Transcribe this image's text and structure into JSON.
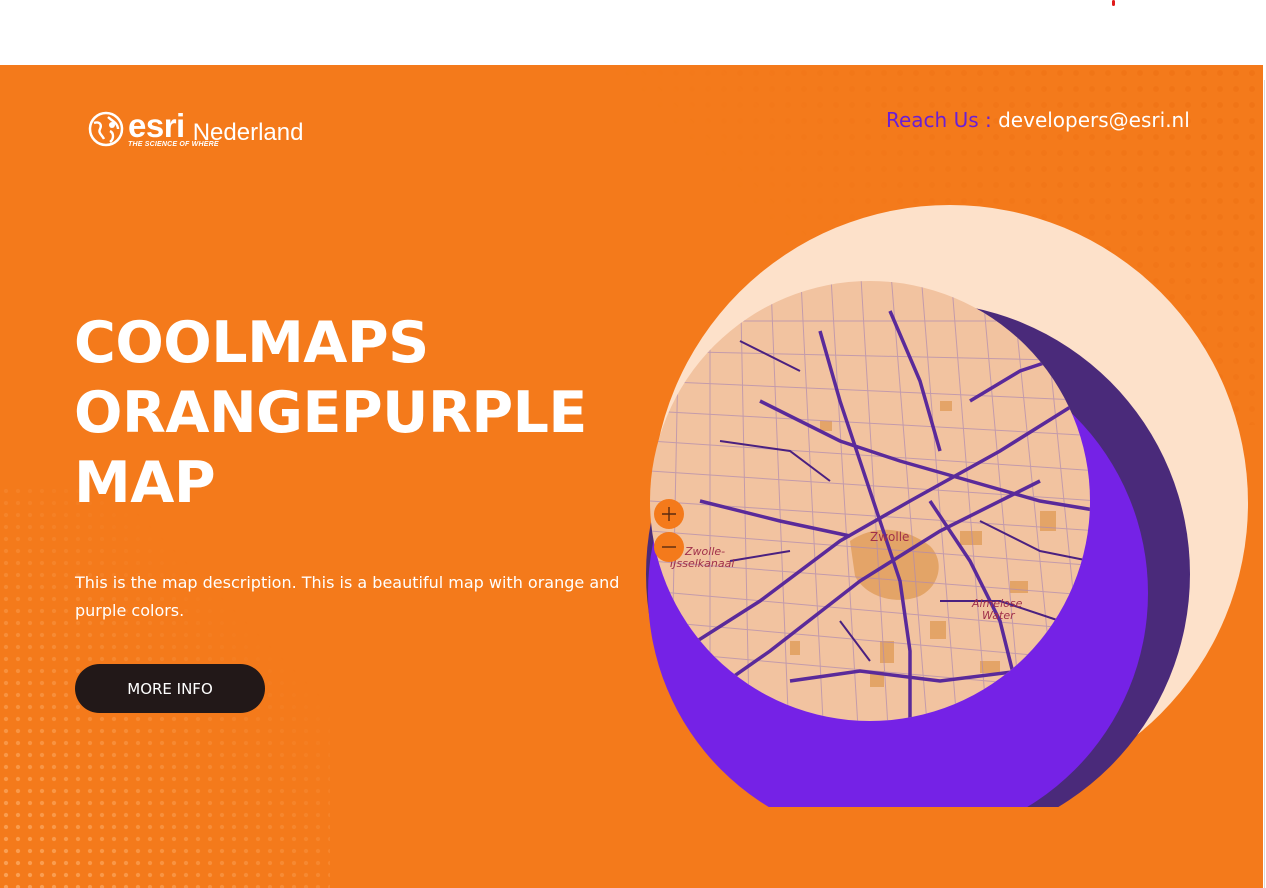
{
  "header": {
    "logo": {
      "brand": "esri",
      "country": "Nederland",
      "tagline": "THE SCIENCE OF WHERE"
    },
    "reach_label": "Reach Us :",
    "reach_email": "developers@esri.nl"
  },
  "hero": {
    "title_lines": [
      "COOLMAPS",
      "ORANGEPURPLE",
      "MAP"
    ],
    "description": "This is the map description. This is a beautiful map with orange and purple colors.",
    "more_info_label": "MORE INFO"
  },
  "map": {
    "labels": [
      "Zwolle",
      "Zwolle-",
      "IJsselkanaal",
      "Almelose",
      "Water"
    ],
    "zoom_in_icon": "plus-icon",
    "zoom_out_icon": "minus-icon"
  },
  "colors": {
    "background": "#f47a1b",
    "accent_purple": "#6a1fd6",
    "dark_purple": "#4a2a7a",
    "peach": "#fde1ca",
    "button": "#221818"
  }
}
